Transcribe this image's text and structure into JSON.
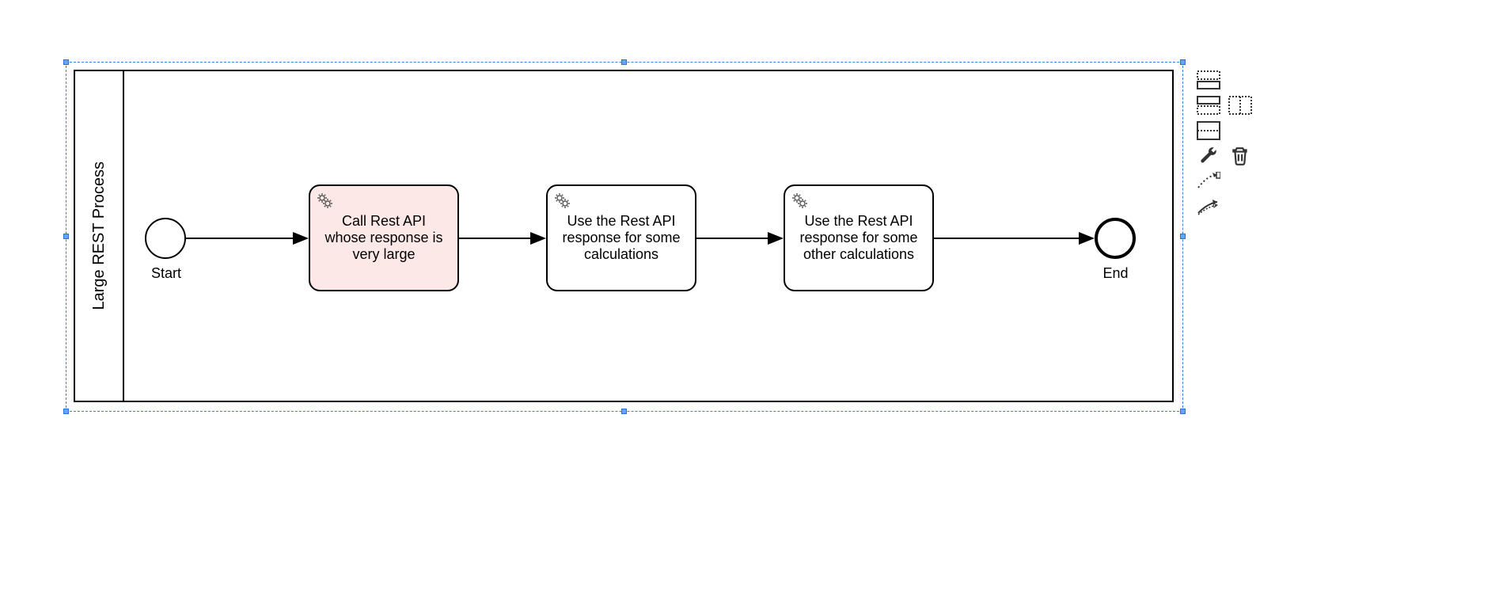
{
  "pool": {
    "title": "Large REST Process"
  },
  "events": {
    "start_label": "Start",
    "end_label": "End"
  },
  "tasks": {
    "t1": "Call Rest API whose response is very large",
    "t2": "Use the Rest API response for some calculations",
    "t3": "Use the Rest API response for some other calculations"
  },
  "toolbar_icons": {
    "i1": "lane-below-icon",
    "i2": "lane-above-icon",
    "i3": "lane-right-icon",
    "i4": "lane-three-icon",
    "i5": "wrench-icon",
    "i6": "trash-icon",
    "i7": "connect-solid-icon",
    "i8": "connect-dashed-icon"
  }
}
